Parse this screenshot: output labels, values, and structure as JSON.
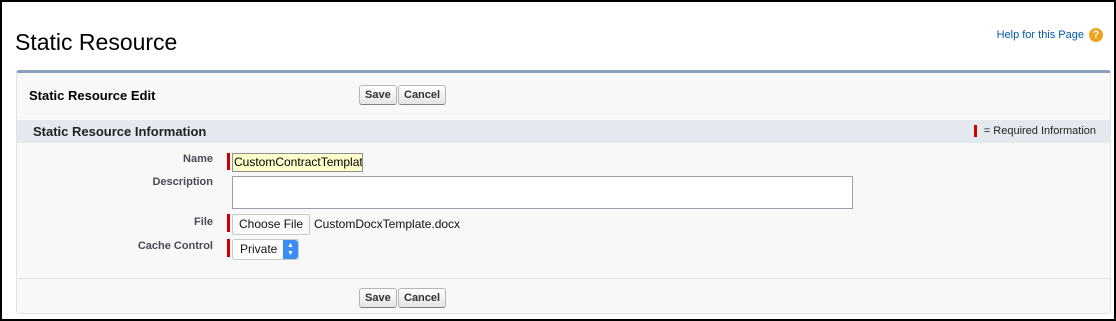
{
  "page": {
    "title": "Static Resource",
    "help_link": "Help for this Page",
    "help_icon": "question-icon"
  },
  "edit_panel": {
    "title": "Static Resource Edit",
    "save_label": "Save",
    "cancel_label": "Cancel"
  },
  "section": {
    "title": "Static Resource Information",
    "required_legend": "= Required Information"
  },
  "fields": {
    "name": {
      "label": "Name",
      "value": "CustomContractTemplat",
      "required": true
    },
    "description": {
      "label": "Description",
      "value": "",
      "required": false
    },
    "file": {
      "label": "File",
      "button_label": "Choose File",
      "file_name": "CustomDocxTemplate.docx",
      "required": true
    },
    "cache_control": {
      "label": "Cache Control",
      "selected": "Private",
      "required": true
    }
  },
  "footer": {
    "save_label": "Save",
    "cancel_label": "Cancel"
  },
  "colors": {
    "required_marker": "#cc0000",
    "link": "#015ba7",
    "section_bar": "#e3e9ef",
    "panel_top_border": "#8a9ebe",
    "help_icon": "#f0a21b",
    "select_arrows": "#3d8cf5",
    "name_field_bg": "#ffffcc"
  }
}
